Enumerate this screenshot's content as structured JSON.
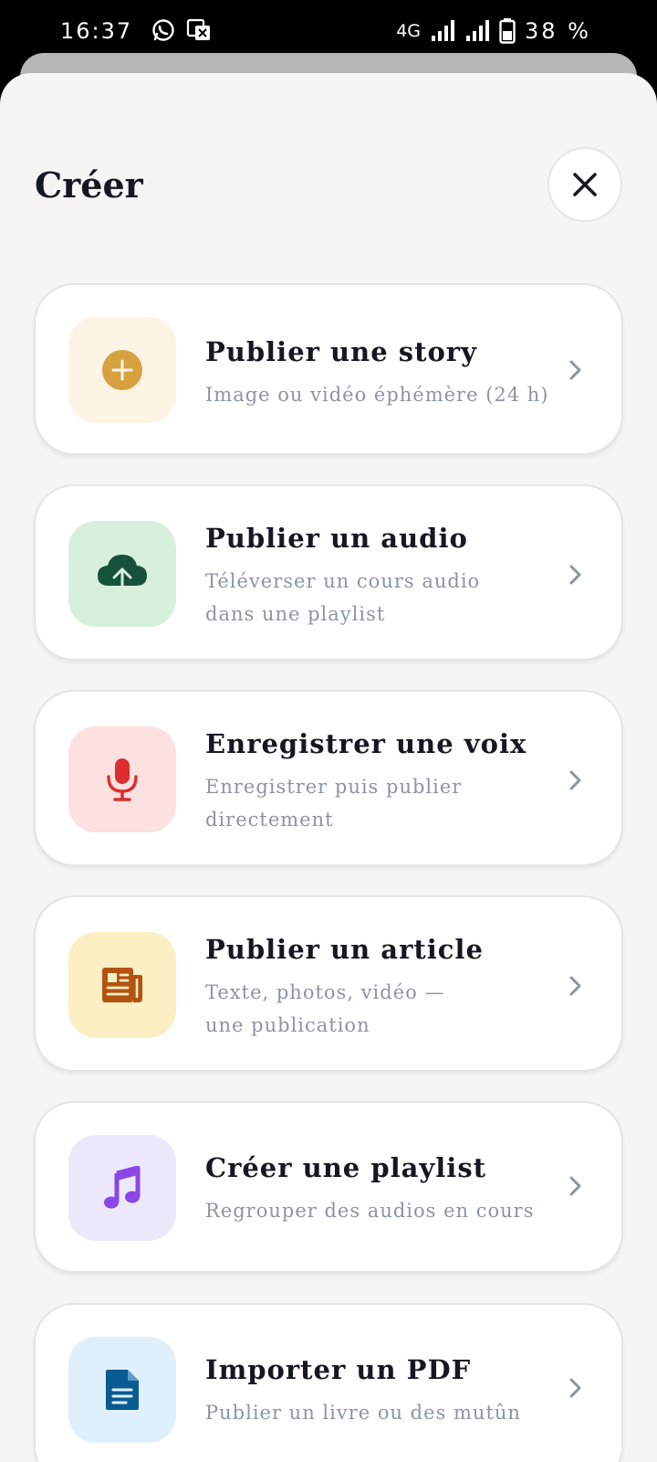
{
  "status_bar": {
    "time": "16:37",
    "network": "4G",
    "battery": "38 %"
  },
  "sheet": {
    "title": "Créer"
  },
  "items": [
    {
      "title": "Publier une story",
      "subtitle": "Image ou vidéo éphémère (24 h)",
      "icon": "plus-circle-icon",
      "tile_color": "#fdf4e6",
      "icon_color": "#d6a23f"
    },
    {
      "title": "Publier un audio",
      "subtitle": "Téléverser un cours audio dans une playlist",
      "icon": "cloud-upload-icon",
      "tile_color": "#d7f0dd",
      "icon_color": "#17513a"
    },
    {
      "title": "Enregistrer une voix",
      "subtitle": "Enregistrer puis publier directement",
      "icon": "microphone-icon",
      "tile_color": "#fde0e0",
      "icon_color": "#dc2e2e"
    },
    {
      "title": "Publier un article",
      "subtitle": "Texte, photos, vidéo — une publication",
      "icon": "newspaper-icon",
      "tile_color": "#fcefc4",
      "icon_color": "#b4520f"
    },
    {
      "title": "Créer une playlist",
      "subtitle": "Regrouper des audios en cours",
      "icon": "music-note-icon",
      "tile_color": "#ede9fd",
      "icon_color": "#8b46e6"
    },
    {
      "title": "Importer un PDF",
      "subtitle": "Publier un livre ou des mutûn",
      "icon": "document-icon",
      "tile_color": "#dff0fc",
      "icon_color": "#0a5a94"
    }
  ]
}
